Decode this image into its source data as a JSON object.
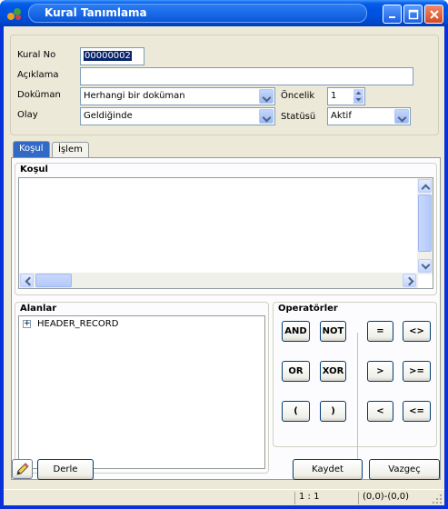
{
  "window": {
    "title": "Kural Tanımlama"
  },
  "header": {
    "rule_no_label": "Kural No",
    "rule_no_value": "00000002",
    "description_label": "Açıklama",
    "description_value": "",
    "document_label": "Doküman",
    "document_value": "Herhangi bir doküman",
    "event_label": "Olay",
    "event_value": "Geldiğinde",
    "priority_label": "Öncelik",
    "priority_value": "1",
    "status_label": "Statüsü",
    "status_value": "Aktif"
  },
  "tabs": [
    {
      "label": "Koşul",
      "active": true
    },
    {
      "label": "İşlem",
      "active": false
    }
  ],
  "condition": {
    "group_label": "Koşul",
    "text": ""
  },
  "fields": {
    "group_label": "Alanlar",
    "tree": [
      {
        "expand": "+",
        "label": "HEADER_RECORD"
      }
    ]
  },
  "operators": {
    "group_label": "Operatörler",
    "logical": [
      "AND",
      "NOT",
      "OR",
      "XOR",
      "(",
      ")"
    ],
    "comparison": [
      "=",
      "<>",
      ">",
      ">=",
      "<",
      "<="
    ]
  },
  "footer": {
    "compile_label": "Derle",
    "save_label": "Kaydet",
    "cancel_label": "Vazgeç"
  },
  "statusbar": {
    "cursor": "1 : 1",
    "range": "(0,0)-(0,0)"
  }
}
